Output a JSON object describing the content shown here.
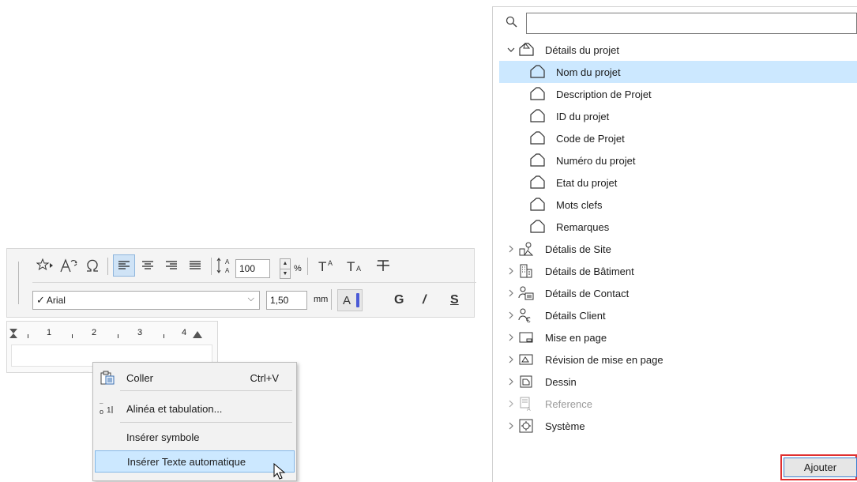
{
  "toolbar": {
    "font_name": "Arial",
    "font_size": "1,50",
    "size_unit": "mm",
    "scale_value": "100",
    "scale_unit": "%",
    "color_swatch_letter": "A",
    "bold_label": "G",
    "italic_label": "/",
    "underline_label": "S",
    "accent_color": "#4a5ad6"
  },
  "ruler": {
    "numbers": [
      "1",
      "2",
      "3",
      "4"
    ]
  },
  "context_menu": {
    "items": [
      {
        "label": "Coller",
        "shortcut": "Ctrl+V",
        "icon": "paste-icon"
      },
      {
        "label": "Alinéa et tabulation...",
        "icon": "paragraph-tab-icon"
      },
      {
        "label": "Insérer symbole"
      },
      {
        "label": "Insérer Texte automatique",
        "highlighted": true
      }
    ]
  },
  "panel": {
    "search": {
      "value": "",
      "placeholder": ""
    },
    "tree": {
      "project": {
        "label": "Détails du projet",
        "children": [
          "Nom du projet",
          "Description de Projet",
          "ID du projet",
          "Code de Projet",
          "Numéro du projet",
          "Etat du projet",
          "Mots clefs",
          "Remarques"
        ]
      },
      "groups": [
        "Détalis de Site",
        "Détails de Bâtiment",
        "Détails de Contact",
        "Détails Client",
        "Mise en page",
        "Révision de mise en page",
        "Dessin",
        "Reference",
        "Système"
      ]
    },
    "add_button": "Ajouter"
  }
}
